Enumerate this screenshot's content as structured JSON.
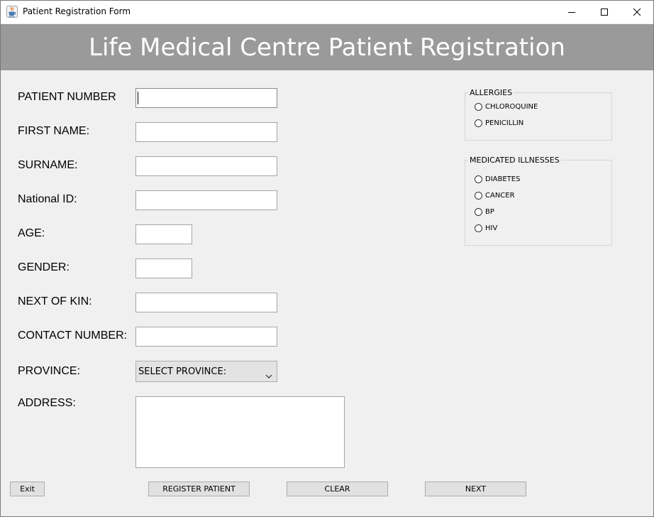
{
  "window": {
    "title": "Patient Registration Form",
    "icons": {
      "app": "java-cup-icon",
      "minimize": "minimize-icon",
      "maximize": "maximize-icon",
      "close": "close-icon"
    }
  },
  "header": {
    "title": "Life Medical Centre Patient Registration"
  },
  "form": {
    "patient_number": {
      "label": "PATIENT NUMBER",
      "value": ""
    },
    "first_name": {
      "label": "FIRST NAME:",
      "value": ""
    },
    "surname": {
      "label": "SURNAME:",
      "value": ""
    },
    "national_id": {
      "label": "National ID:",
      "value": ""
    },
    "age": {
      "label": "AGE:",
      "value": ""
    },
    "gender": {
      "label": "GENDER:",
      "value": ""
    },
    "next_of_kin": {
      "label": "NEXT OF KIN:",
      "value": ""
    },
    "contact_number": {
      "label": "CONTACT NUMBER:",
      "value": ""
    },
    "province": {
      "label": "PROVINCE:",
      "selected": "SELECT PROVINCE:"
    },
    "address": {
      "label": "ADDRESS:",
      "value": ""
    }
  },
  "allergies": {
    "title": "ALLERGIES",
    "options": [
      {
        "label": "CHLOROQUINE",
        "checked": false
      },
      {
        "label": "PENICILLIN",
        "checked": false
      }
    ]
  },
  "illnesses": {
    "title": "MEDICATED ILLNESSES",
    "options": [
      {
        "label": "DIABETES",
        "checked": false
      },
      {
        "label": "CANCER",
        "checked": false
      },
      {
        "label": "BP",
        "checked": false
      },
      {
        "label": "HIV",
        "checked": false
      }
    ]
  },
  "buttons": {
    "exit": "Exit",
    "register": "REGISTER PATIENT",
    "clear": "CLEAR",
    "next": "NEXT"
  }
}
